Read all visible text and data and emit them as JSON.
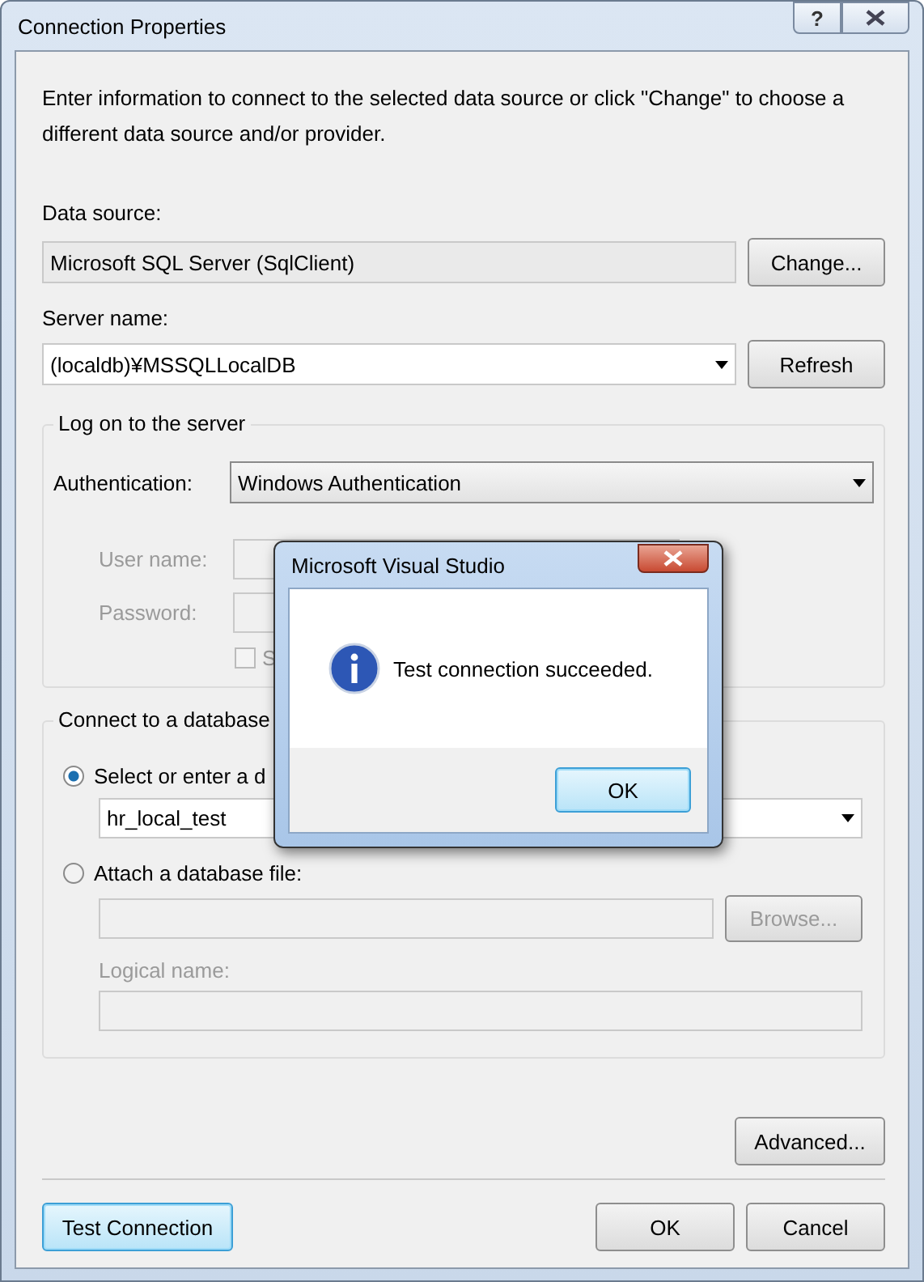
{
  "window": {
    "title": "Connection Properties",
    "help_button": "?"
  },
  "instructions": "Enter information to connect to the selected data source or click \"Change\" to choose a different data source and/or provider.",
  "data_source": {
    "label": "Data source:",
    "value": "Microsoft SQL Server (SqlClient)",
    "button": "Change..."
  },
  "server_name": {
    "label": "Server name:",
    "value": "(localdb)¥MSSQLLocalDB",
    "button": "Refresh"
  },
  "log_on": {
    "title": "Log on to the server",
    "authentication": {
      "label": "Authentication:",
      "value": "Windows Authentication"
    },
    "fields": [
      {
        "label": "User name:",
        "disabled": true
      },
      {
        "label": "Password:",
        "disabled": true
      }
    ],
    "save_password": {
      "label": "S",
      "checked": false,
      "disabled": true
    }
  },
  "database": {
    "title": "Connect to a database",
    "options": [
      {
        "label": "Select or enter a d",
        "selected": true
      },
      {
        "label": "Attach a database file:",
        "selected": false
      }
    ],
    "database_name": "hr_local_test",
    "browse_button": "Browse...",
    "logical_name": {
      "label": "Logical name:",
      "disabled": true
    }
  },
  "advanced_button": "Advanced...",
  "footer_buttons": [
    {
      "label": "Test Connection",
      "focused": true
    },
    {
      "label": "OK",
      "focused": false
    },
    {
      "label": "Cancel",
      "focused": false
    }
  ],
  "message_box": {
    "title": "Microsoft Visual Studio",
    "message": "Test connection succeeded.",
    "button": "OK"
  }
}
